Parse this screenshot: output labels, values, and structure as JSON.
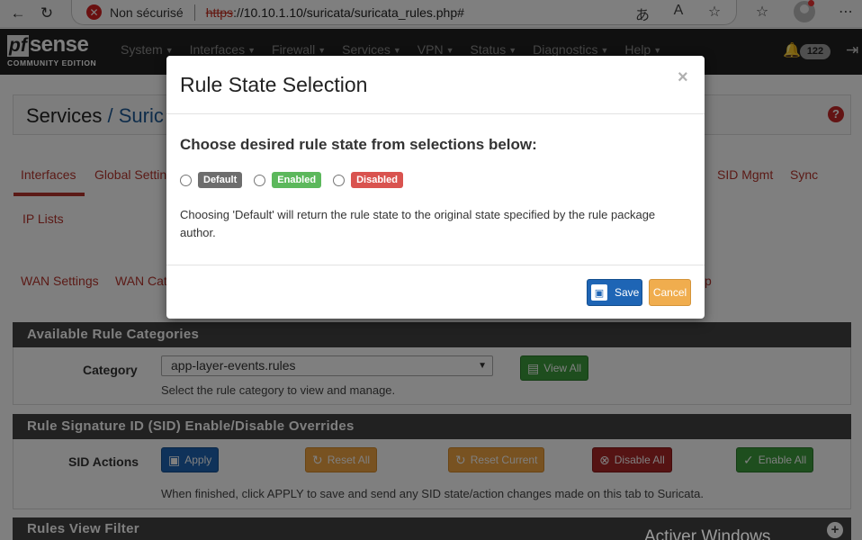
{
  "browser": {
    "security_label": "Non sécurisé",
    "url_scheme": "https",
    "url_rest": "://10.10.1.10/suricata/suricata_rules.php#"
  },
  "brand": {
    "logo_pf": "pf",
    "logo_sense": "sense",
    "edition": "COMMUNITY EDITION"
  },
  "navbar": {
    "menu": [
      "System",
      "Interfaces",
      "Firewall",
      "Services",
      "VPN",
      "Status",
      "Diagnostics",
      "Help"
    ],
    "notification_count": "122"
  },
  "breadcrumb": {
    "root": "Services",
    "separator": "/",
    "current": "Suric"
  },
  "tabs": {
    "row1": [
      "Interfaces",
      "Global Settin",
      "SID Mgmt",
      "Sync"
    ],
    "row2": [
      "IP Lists"
    ],
    "row3": [
      "WAN Settings",
      "WAN Cat",
      "p"
    ]
  },
  "categories_panel": {
    "title": "Available Rule Categories",
    "category_label": "Category",
    "selected_category": "app-layer-events.rules",
    "view_all_label": "View All",
    "help": "Select the rule category to view and manage."
  },
  "sid_panel": {
    "title": "Rule Signature ID (SID) Enable/Disable Overrides",
    "actions_label": "SID Actions",
    "apply_label": "Apply",
    "reset_all_label": "Reset All",
    "reset_current_label": "Reset Current",
    "disable_all_label": "Disable All",
    "enable_all_label": "Enable All",
    "help": "When finished, click APPLY to save and send any SID state/action changes made on this tab to Suricata."
  },
  "filter_panel": {
    "title": "Rules View Filter"
  },
  "watermark": "Activer Windows",
  "modal": {
    "title": "Rule State Selection",
    "close": "×",
    "heading": "Choose desired rule state from selections below:",
    "options": [
      "Default",
      "Enabled",
      "Disabled"
    ],
    "note": "Choosing 'Default' will return the rule state to the original state specified by the rule package author.",
    "save_label": "Save",
    "cancel_label": "Cancel"
  },
  "colors": {
    "navbar": "#212121",
    "link_red": "#b7352d",
    "primary_blue": "#1e65b5",
    "warning_orange": "#f0ad4e",
    "success_green": "#5cb85c",
    "danger_red": "#d9534f"
  }
}
